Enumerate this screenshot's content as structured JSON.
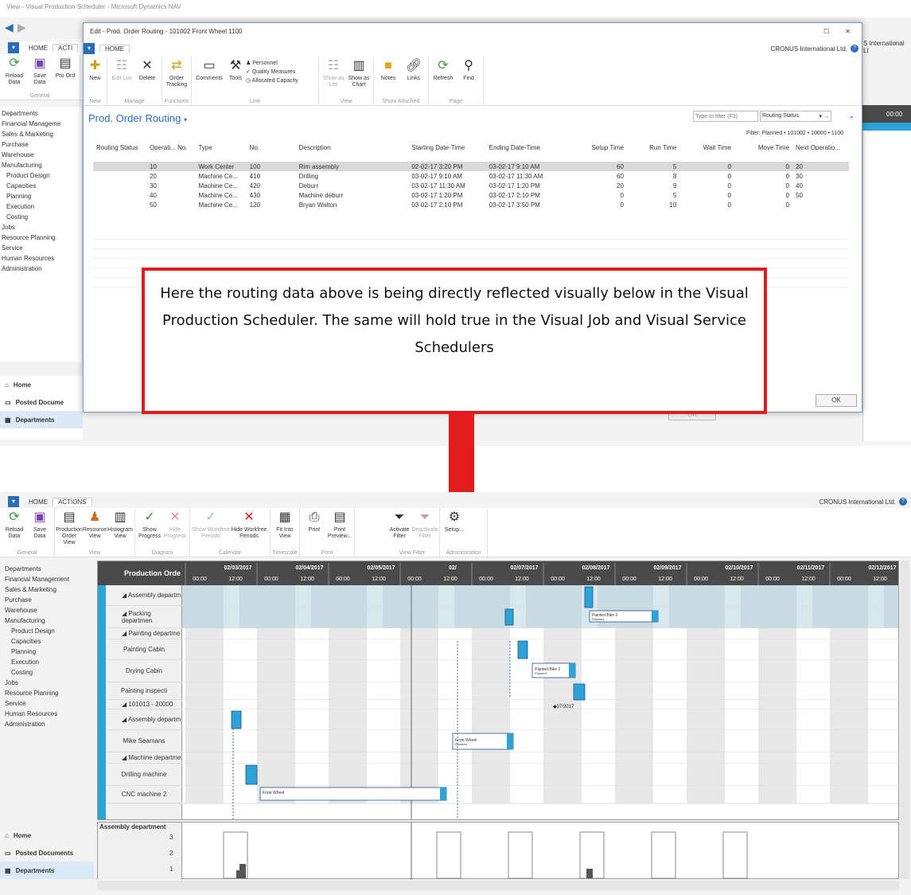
{
  "window": {
    "title": "View - Visual Production Scheduler - Microsoft Dynamics NAV"
  },
  "bg_ribbon": {
    "tabs": [
      "HOME",
      "ACTI"
    ],
    "buttons": [
      {
        "label": "Reload Data"
      },
      {
        "label": "Save Data"
      },
      {
        "label": "Pro Ord"
      }
    ],
    "group": "General"
  },
  "bg_right": {
    "company": "S International Lt",
    "time": "00:00"
  },
  "nav": {
    "items": [
      "Departments",
      "Financial Manageme",
      "Sales & Marketing",
      "Purchase",
      "Warehouse",
      "Manufacturing",
      "Product Design",
      "Capacities",
      "Planning",
      "Execution",
      "Costing",
      "Jobs",
      "Resource Planning",
      "Service",
      "Human Resources",
      "Administration"
    ],
    "bottom": [
      "Home",
      "Posted Docume",
      "Departments"
    ]
  },
  "dialog": {
    "title": "Edit - Prod. Order Routing - 101002 Front Wheel 1100",
    "tab": "HOME",
    "company": "CRONUS International Ltd.",
    "groups": [
      {
        "name": "New",
        "buttons": [
          "New"
        ]
      },
      {
        "name": "Manage",
        "buttons": [
          "Edit List",
          "Delete"
        ]
      },
      {
        "name": "Functions",
        "buttons": [
          "Order Tracking"
        ]
      },
      {
        "name": "Line",
        "buttons": [
          "Comments",
          "Tools"
        ],
        "small": [
          "Personnel",
          "Quality Measures",
          "Allocated Capacity"
        ]
      },
      {
        "name": "View",
        "buttons": [
          "Show as List",
          "Show as Chart"
        ]
      },
      {
        "name": "Show Attached",
        "buttons": [
          "Notes",
          "Links"
        ]
      },
      {
        "name": "Page",
        "buttons": [
          "Refresh",
          "Find"
        ]
      }
    ],
    "page_title": "Prod. Order Routing",
    "filter_placeholder": "Type to filter (F3)",
    "filter_field": "Routing Status",
    "filter_text": "Filter: Planned • 101002 • 10000 • 1100",
    "columns": [
      "Routing Status",
      "Operati... No.",
      "Type",
      "No.",
      "Description",
      "Starting Date-Time",
      "Ending Date-Time",
      "Setup Time",
      "Run Time",
      "Wait Time",
      "Move Time",
      "Next Operatio..."
    ],
    "rows": [
      [
        "",
        "10",
        "Work Center",
        "100",
        "Rim assembly",
        "02-02-17 3:20 PM",
        "03-02-17 9:10 AM",
        "60",
        "5",
        "0",
        "0",
        "20"
      ],
      [
        "",
        "20",
        "Machine Ce...",
        "410",
        "Drilling",
        "03-02-17 9:10 AM",
        "03-02-17 11:30 AM",
        "60",
        "8",
        "0",
        "0",
        "30"
      ],
      [
        "",
        "30",
        "Machine Ce...",
        "420",
        "Deburr",
        "03-02-17 11:30 AM",
        "03-02-17 1:20 PM",
        "20",
        "9",
        "0",
        "0",
        "40"
      ],
      [
        "",
        "40",
        "Machine Ce...",
        "430",
        "Machine deburr",
        "03-02-17 1:20 PM",
        "03-02-17 2:10 PM",
        "0",
        "5",
        "0",
        "0",
        "50"
      ],
      [
        "",
        "50",
        "Machine Ce...",
        "120",
        "Bryan Walton",
        "03-02-17 2:10 PM",
        "03-02-17 3:50 PM",
        "0",
        "10",
        "0",
        "0",
        ""
      ]
    ],
    "ok_label": "OK",
    "ok_label_bg": "OK"
  },
  "callout": {
    "text": "Here the routing data above is being directly reflected visually below in the Visual Production Scheduler. The same will hold true in the Visual Job and Visual Service Schedulers"
  },
  "scheduler": {
    "tabs": [
      "HOME",
      "ACTIONS"
    ],
    "company": "CRONUS International Ltd.",
    "groups": [
      {
        "name": "General",
        "buttons": [
          "Reload Data",
          "Save Data"
        ]
      },
      {
        "name": "View",
        "buttons": [
          "Production Order View",
          "Resource View",
          "Histogram View"
        ]
      },
      {
        "name": "Diagram",
        "buttons": [
          "Show Progress",
          "Hide Progress"
        ]
      },
      {
        "name": "Calendar",
        "buttons": [
          "Show Workfree Periods",
          "Hide Workfree Periods"
        ]
      },
      {
        "name": "Timescale",
        "buttons": [
          "Fit Into View"
        ]
      },
      {
        "name": "Print",
        "buttons": [
          "Print",
          "Print Preview..."
        ]
      },
      {
        "name": "View Filter",
        "buttons": [
          "Activate Filter",
          "Deactivate Filter"
        ]
      },
      {
        "name": "Administration",
        "buttons": [
          "Setup..."
        ]
      }
    ],
    "nav_items": [
      "Departments",
      "Financial Management",
      "Sales & Marketing",
      "Purchase",
      "Warehouse",
      "Manufacturing",
      "Product Design",
      "Capacities",
      "Planning",
      "Execution",
      "Costing",
      "Jobs",
      "Resource Planning",
      "Service",
      "Human Resources",
      "Administration"
    ],
    "nav_bottom": [
      "Home",
      "Posted Documents",
      "Departments"
    ],
    "header": "Production Orde",
    "dates": [
      "02/03/2017",
      "02/04/2017",
      "02/05/2017",
      "02/",
      "02/07/2017",
      "02/08/2017",
      "02/09/2017",
      "02/10/2017",
      "02/11/2017",
      "02/12/2017"
    ],
    "hours": [
      "00:00",
      "12:00"
    ],
    "rows": [
      "◢ Assembly departm",
      "◢ Packing departmen",
      "◢ Painting departme",
      "Painting Cabin",
      "Drying Cabin",
      "Painting inspecti",
      "◢ 101013 - 20000",
      "◢ Assembly departm",
      "Mike Seamans",
      "◢ Machine departme",
      "Drilling machine",
      "CNC machine 2"
    ],
    "bar_labels": {
      "painted_bike": "Painted Bike 2",
      "planned": "Planned",
      "front_wheel": "Front Wheel",
      "milestone": "◆07/2017"
    },
    "histogram": {
      "title": "Assembly department",
      "ticks": [
        "3",
        "2",
        "1"
      ]
    }
  },
  "colors": {
    "accent": "#2a6ebb",
    "callout_border": "#e31b1b",
    "arrow": "#e31b1b",
    "bar": "#2ea3d8"
  }
}
